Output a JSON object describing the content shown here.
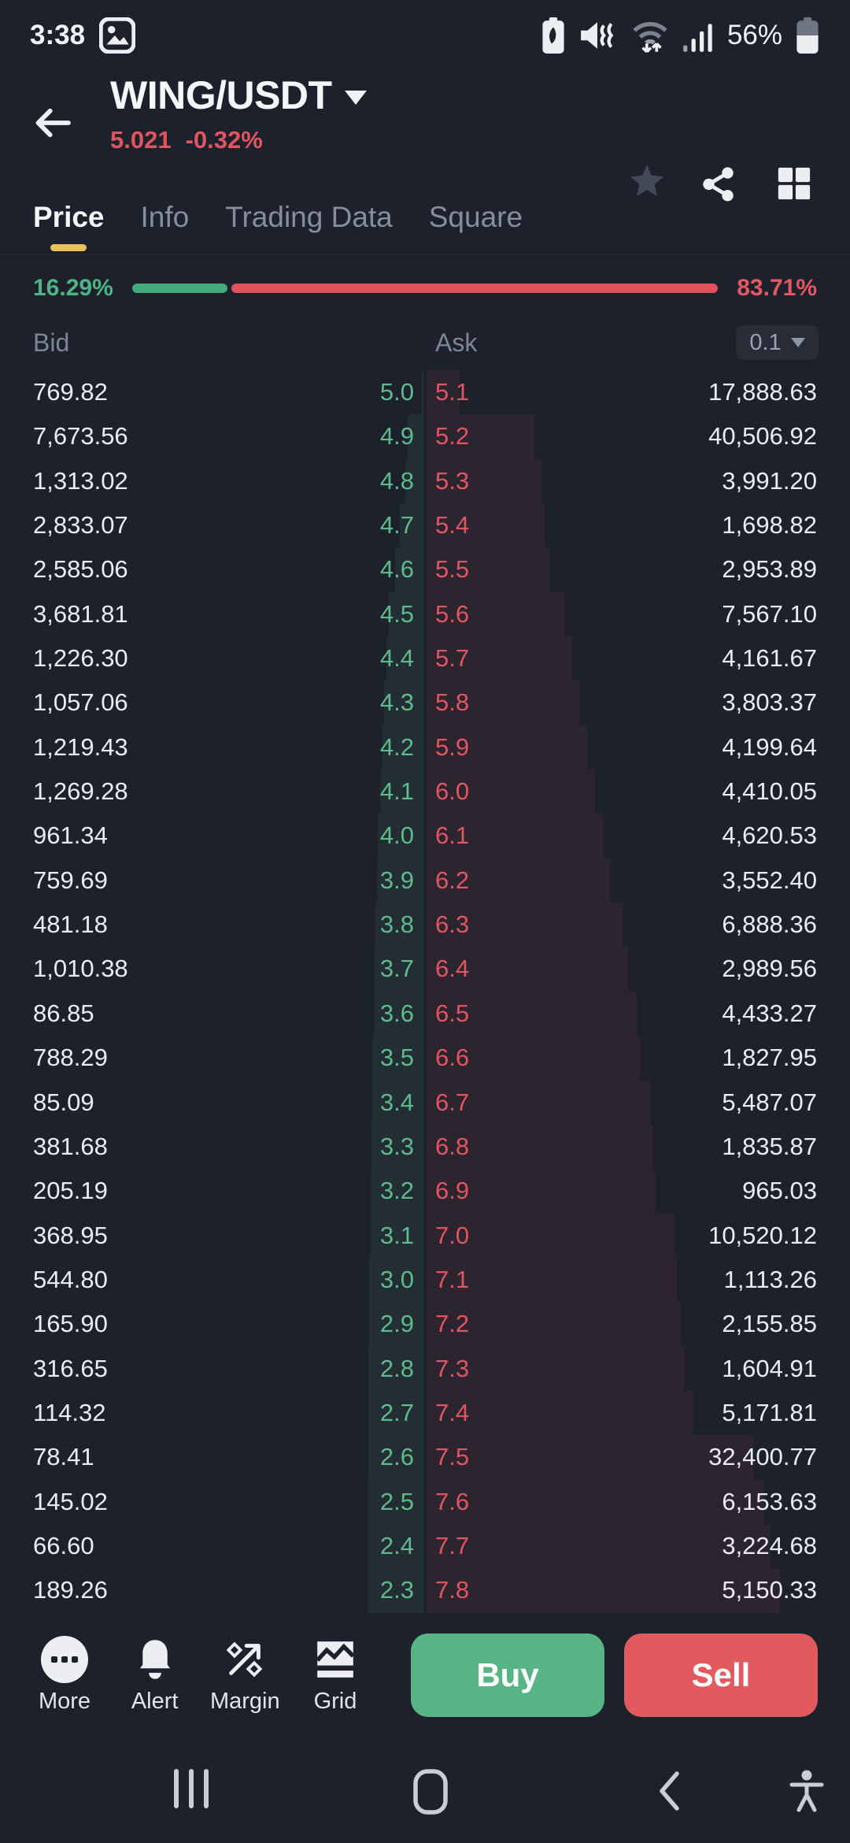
{
  "status_bar": {
    "time": "3:38",
    "battery": "56%"
  },
  "header": {
    "pair": "WING/USDT",
    "price": "5.021",
    "change": "-0.32%"
  },
  "tabs": {
    "active_index": 0,
    "items": [
      {
        "label": "Price"
      },
      {
        "label": "Info"
      },
      {
        "label": "Trading Data"
      },
      {
        "label": "Square"
      }
    ]
  },
  "depth": {
    "bid_percent": "16.29%",
    "ask_percent": "83.71%",
    "bid_ratio": 0.1629
  },
  "order_book": {
    "bid_header": "Bid",
    "ask_header": "Ask",
    "tick_size": "0.1",
    "rows": [
      {
        "bid_amount": "769.82",
        "bid_price": "5.0",
        "ask_price": "5.1",
        "ask_amount": "17,888.63"
      },
      {
        "bid_amount": "7,673.56",
        "bid_price": "4.9",
        "ask_price": "5.2",
        "ask_amount": "40,506.92"
      },
      {
        "bid_amount": "1,313.02",
        "bid_price": "4.8",
        "ask_price": "5.3",
        "ask_amount": "3,991.20"
      },
      {
        "bid_amount": "2,833.07",
        "bid_price": "4.7",
        "ask_price": "5.4",
        "ask_amount": "1,698.82"
      },
      {
        "bid_amount": "2,585.06",
        "bid_price": "4.6",
        "ask_price": "5.5",
        "ask_amount": "2,953.89"
      },
      {
        "bid_amount": "3,681.81",
        "bid_price": "4.5",
        "ask_price": "5.6",
        "ask_amount": "7,567.10"
      },
      {
        "bid_amount": "1,226.30",
        "bid_price": "4.4",
        "ask_price": "5.7",
        "ask_amount": "4,161.67"
      },
      {
        "bid_amount": "1,057.06",
        "bid_price": "4.3",
        "ask_price": "5.8",
        "ask_amount": "3,803.37"
      },
      {
        "bid_amount": "1,219.43",
        "bid_price": "4.2",
        "ask_price": "5.9",
        "ask_amount": "4,199.64"
      },
      {
        "bid_amount": "1,269.28",
        "bid_price": "4.1",
        "ask_price": "6.0",
        "ask_amount": "4,410.05"
      },
      {
        "bid_amount": "961.34",
        "bid_price": "4.0",
        "ask_price": "6.1",
        "ask_amount": "4,620.53"
      },
      {
        "bid_amount": "759.69",
        "bid_price": "3.9",
        "ask_price": "6.2",
        "ask_amount": "3,552.40"
      },
      {
        "bid_amount": "481.18",
        "bid_price": "3.8",
        "ask_price": "6.3",
        "ask_amount": "6,888.36"
      },
      {
        "bid_amount": "1,010.38",
        "bid_price": "3.7",
        "ask_price": "6.4",
        "ask_amount": "2,989.56"
      },
      {
        "bid_amount": "86.85",
        "bid_price": "3.6",
        "ask_price": "6.5",
        "ask_amount": "4,433.27"
      },
      {
        "bid_amount": "788.29",
        "bid_price": "3.5",
        "ask_price": "6.6",
        "ask_amount": "1,827.95"
      },
      {
        "bid_amount": "85.09",
        "bid_price": "3.4",
        "ask_price": "6.7",
        "ask_amount": "5,487.07"
      },
      {
        "bid_amount": "381.68",
        "bid_price": "3.3",
        "ask_price": "6.8",
        "ask_amount": "1,835.87"
      },
      {
        "bid_amount": "205.19",
        "bid_price": "3.2",
        "ask_price": "6.9",
        "ask_amount": "965.03"
      },
      {
        "bid_amount": "368.95",
        "bid_price": "3.1",
        "ask_price": "7.0",
        "ask_amount": "10,520.12"
      },
      {
        "bid_amount": "544.80",
        "bid_price": "3.0",
        "ask_price": "7.1",
        "ask_amount": "1,113.26"
      },
      {
        "bid_amount": "165.90",
        "bid_price": "2.9",
        "ask_price": "7.2",
        "ask_amount": "2,155.85"
      },
      {
        "bid_amount": "316.65",
        "bid_price": "2.8",
        "ask_price": "7.3",
        "ask_amount": "1,604.91"
      },
      {
        "bid_amount": "114.32",
        "bid_price": "2.7",
        "ask_price": "7.4",
        "ask_amount": "5,171.81"
      },
      {
        "bid_amount": "78.41",
        "bid_price": "2.6",
        "ask_price": "7.5",
        "ask_amount": "32,400.77"
      },
      {
        "bid_amount": "145.02",
        "bid_price": "2.5",
        "ask_price": "7.6",
        "ask_amount": "6,153.63"
      },
      {
        "bid_amount": "66.60",
        "bid_price": "2.4",
        "ask_price": "7.7",
        "ask_amount": "3,224.68"
      },
      {
        "bid_amount": "189.26",
        "bid_price": "2.3",
        "ask_price": "7.8",
        "ask_amount": "5,150.33"
      }
    ]
  },
  "actions": {
    "more": "More",
    "alert": "Alert",
    "margin": "Margin",
    "grid": "Grid",
    "buy": "Buy",
    "sell": "Sell"
  },
  "colors": {
    "background": "#1d212b",
    "text_green": "#5fba8c",
    "text_red": "#e15560",
    "depth_green": "#43aa7e",
    "depth_red": "#e0525c",
    "buy_button": "#57b585",
    "sell_button": "#e35a5e",
    "tab_underline": "#e8c158"
  }
}
